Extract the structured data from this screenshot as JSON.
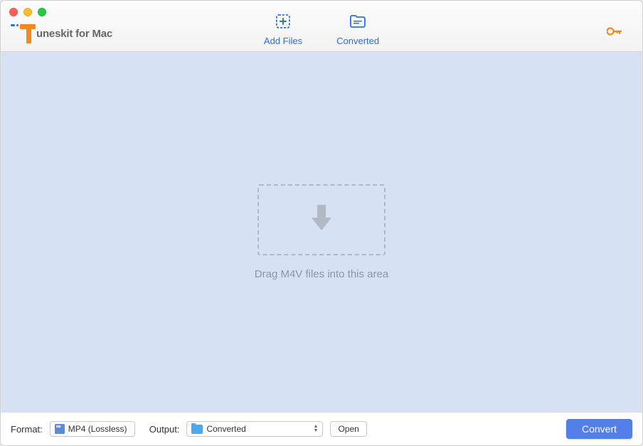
{
  "app": {
    "name": "uneskit for Mac"
  },
  "toolbar": {
    "add_files": "Add Files",
    "converted": "Converted"
  },
  "drop": {
    "hint": "Drag M4V files into this area"
  },
  "bottom": {
    "format_label": "Format:",
    "format_value": "MP4 (Lossless)",
    "output_label": "Output:",
    "output_value": "Converted",
    "open_label": "Open",
    "convert_label": "Convert"
  },
  "colors": {
    "accent_blue": "#2a6fe8",
    "accent_orange": "#f28a1f",
    "drop_bg": "#d6e1f3",
    "convert_bg": "#5280e8"
  }
}
